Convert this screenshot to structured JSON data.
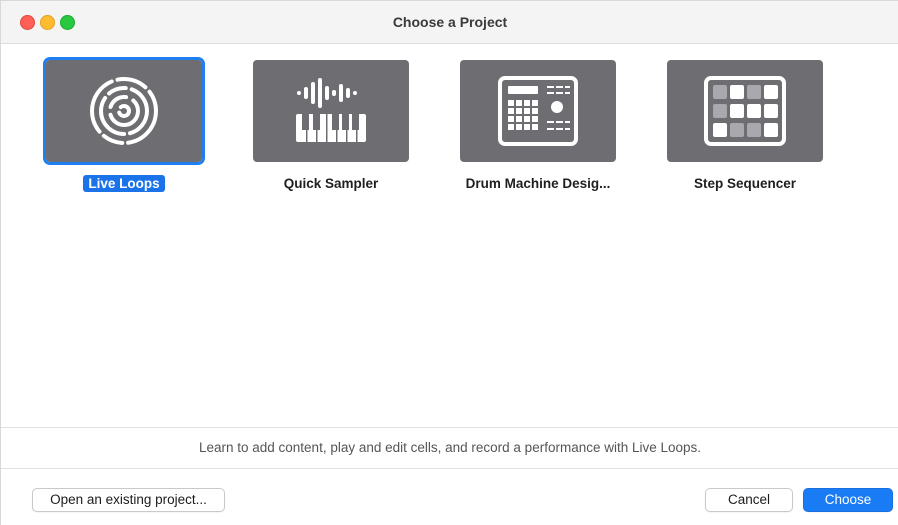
{
  "window": {
    "title": "Choose a Project"
  },
  "projects": [
    {
      "label": "Live Loops",
      "icon": "live-loops-icon",
      "selected": true
    },
    {
      "label": "Quick Sampler",
      "icon": "quick-sampler-icon",
      "selected": false
    },
    {
      "label": "Drum Machine Desig...",
      "icon": "drum-machine-icon",
      "selected": false
    },
    {
      "label": "Step Sequencer",
      "icon": "step-sequencer-icon",
      "selected": false
    }
  ],
  "description": "Learn to add content, play and edit cells, and record a performance with Live Loops.",
  "footer": {
    "open_label": "Open an existing project...",
    "cancel_label": "Cancel",
    "choose_label": "Choose"
  },
  "colors": {
    "accent": "#1a7cf5",
    "tile": "#6e6e72"
  }
}
